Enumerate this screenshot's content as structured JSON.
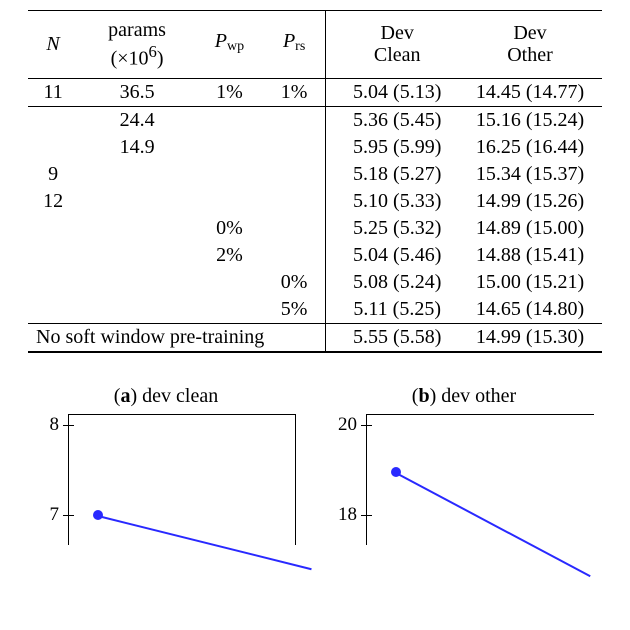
{
  "table": {
    "headers": {
      "n": "N",
      "params_l1": "params",
      "params_l2": "(×10",
      "params_sup": "6",
      "params_l2b": ")",
      "pwp": "P",
      "pwp_sub": "wp",
      "prs": "P",
      "prs_sub": "rs",
      "dev_l1": "Dev",
      "clean": "Clean",
      "other": "Other"
    },
    "r0": {
      "n": "11",
      "p": "36.5",
      "wp": "1%",
      "rs": "1%",
      "dc": "5.04 (5.13)",
      "do": "14.45 (14.77)"
    },
    "r1": {
      "p": "24.4",
      "dc": "5.36 (5.45)",
      "do": "15.16 (15.24)"
    },
    "r2": {
      "p": "14.9",
      "dc": "5.95 (5.99)",
      "do": "16.25 (16.44)"
    },
    "r3": {
      "n": "9",
      "dc": "5.18 (5.27)",
      "do": "15.34 (15.37)"
    },
    "r4": {
      "n": "12",
      "dc": "5.10 (5.33)",
      "do": "14.99 (15.26)"
    },
    "r5": {
      "wp": "0%",
      "dc": "5.25 (5.32)",
      "do": "14.89 (15.00)"
    },
    "r6": {
      "wp": "2%",
      "dc": "5.04 (5.46)",
      "do": "14.88 (15.41)"
    },
    "r7": {
      "rs": "0%",
      "dc": "5.08 (5.24)",
      "do": "15.00 (15.21)"
    },
    "r8": {
      "rs": "5%",
      "dc": "5.11 (5.25)",
      "do": "14.65 (14.80)"
    },
    "noswp": {
      "label": "No soft window pre-training",
      "dc": "5.55 (5.58)",
      "do": "14.99 (15.30)"
    }
  },
  "chart_data": [
    {
      "type": "line",
      "title": "(a) dev clean",
      "x": [
        0
      ],
      "values": [
        7.0
      ],
      "ylim": [
        6.5,
        8
      ],
      "yticks": [
        7,
        8
      ]
    },
    {
      "type": "line",
      "title": "(b) dev other",
      "x": [
        0
      ],
      "values": [
        18.9
      ],
      "ylim": [
        17,
        20
      ],
      "yticks": [
        18,
        20
      ]
    }
  ],
  "charts": {
    "a": {
      "label_bold": "a",
      "label_rest": ") dev clean",
      "t8": "8",
      "t7": "7"
    },
    "b": {
      "label_bold": "b",
      "label_rest": ") dev other",
      "t20": "20",
      "t18": "18"
    }
  }
}
